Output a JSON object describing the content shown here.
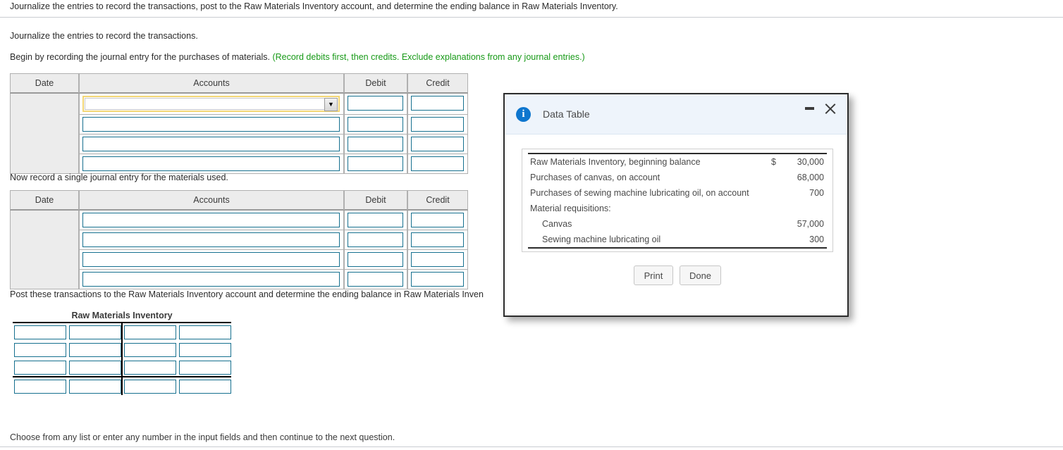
{
  "question": {
    "prompt": "Journalize the entries to record the transactions, post to the Raw Materials Inventory account, and determine the ending balance in Raw Materials Inventory.",
    "step1": "Journalize the entries to record the transactions.",
    "step2_lead": "Begin by recording the journal entry for the purchases of materials.",
    "step2_hint": "(Record debits first, then credits. Exclude explanations from any journal entries.)",
    "step3": "Now record a single journal entry for the materials used.",
    "step4": "Post these transactions to the Raw Materials Inventory account and determine the ending balance in Raw Materials Inven",
    "footer": "Choose from any list or enter any number in the input fields and then continue to the next question."
  },
  "journal1": {
    "headers": [
      "Date",
      "Accounts",
      "Debit",
      "Credit"
    ],
    "rows": [
      {
        "account": "",
        "debit": "",
        "credit": "",
        "dropdown": true
      },
      {
        "account": "",
        "debit": "",
        "credit": "",
        "dropdown": false
      },
      {
        "account": "",
        "debit": "",
        "credit": "",
        "dropdown": false
      },
      {
        "account": "",
        "debit": "",
        "credit": "",
        "dropdown": false
      }
    ],
    "date_value": ""
  },
  "journal2": {
    "headers": [
      "Date",
      "Accounts",
      "Debit",
      "Credit"
    ],
    "rows": [
      {
        "account": "",
        "debit": "",
        "credit": "",
        "dropdown": false
      },
      {
        "account": "",
        "debit": "",
        "credit": "",
        "dropdown": false
      },
      {
        "account": "",
        "debit": "",
        "credit": "",
        "dropdown": false
      },
      {
        "account": "",
        "debit": "",
        "credit": "",
        "dropdown": false
      }
    ],
    "date_value": ""
  },
  "t_account": {
    "title": "Raw Materials Inventory",
    "rows": [
      {
        "debit_ref": "",
        "debit_amt": "",
        "credit_ref": "",
        "credit_amt": ""
      },
      {
        "debit_ref": "",
        "debit_amt": "",
        "credit_ref": "",
        "credit_amt": ""
      },
      {
        "debit_ref": "",
        "debit_amt": "",
        "credit_ref": "",
        "credit_amt": ""
      }
    ],
    "balance_row": {
      "debit_ref": "",
      "debit_amt": "",
      "credit_ref": "",
      "credit_amt": ""
    }
  },
  "dialog": {
    "title": "Data Table",
    "icon": "info-icon",
    "minimize_label": "–",
    "close_label": "✕",
    "table": [
      {
        "label": "Raw Materials Inventory, beginning balance",
        "currency": "$",
        "value": "30,000",
        "indent": false
      },
      {
        "label": "Purchases of canvas, on account",
        "currency": "",
        "value": "68,000",
        "indent": false
      },
      {
        "label": "Purchases of sewing machine lubricating oil, on account",
        "currency": "",
        "value": "700",
        "indent": false
      },
      {
        "label": "Material requisitions:",
        "currency": "",
        "value": "",
        "indent": false
      },
      {
        "label": "Canvas",
        "currency": "",
        "value": "57,000",
        "indent": true
      },
      {
        "label": "Sewing machine lubricating oil",
        "currency": "",
        "value": "300",
        "indent": true
      }
    ],
    "print_label": "Print",
    "done_label": "Done"
  },
  "colors": {
    "hint_green": "#189a18",
    "field_border": "#16708f",
    "active_field": "#f2d675",
    "dialog_header": "#eef4fb",
    "info_blue": "#0e76ce"
  }
}
